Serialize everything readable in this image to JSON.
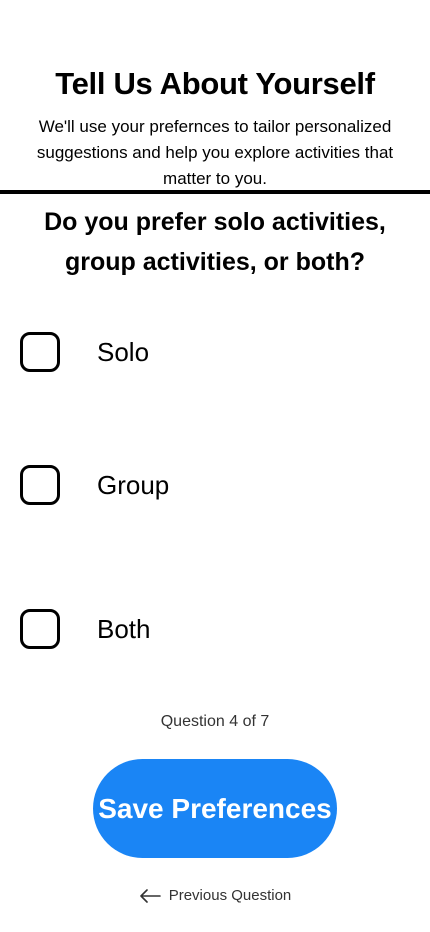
{
  "header": {
    "title": "Tell Us About Yourself",
    "subtitle": "We'll use your prefernces to tailor personalized suggestions and help you explore activities that matter to you."
  },
  "question": {
    "text": "Do you prefer solo activities, group activities, or both?"
  },
  "options": [
    {
      "label": "Solo",
      "checked": false
    },
    {
      "label": "Group",
      "checked": false
    },
    {
      "label": "Both",
      "checked": false
    }
  ],
  "progress": {
    "text": "Question 4 of 7",
    "current": 4,
    "total": 7
  },
  "actions": {
    "save_label": "Save Preferences",
    "previous_label": "Previous Question",
    "previous_icon": "arrow-left-icon"
  },
  "colors": {
    "accent": "#1a85f5",
    "text": "#000000",
    "muted_text": "#333333",
    "background": "#ffffff"
  }
}
